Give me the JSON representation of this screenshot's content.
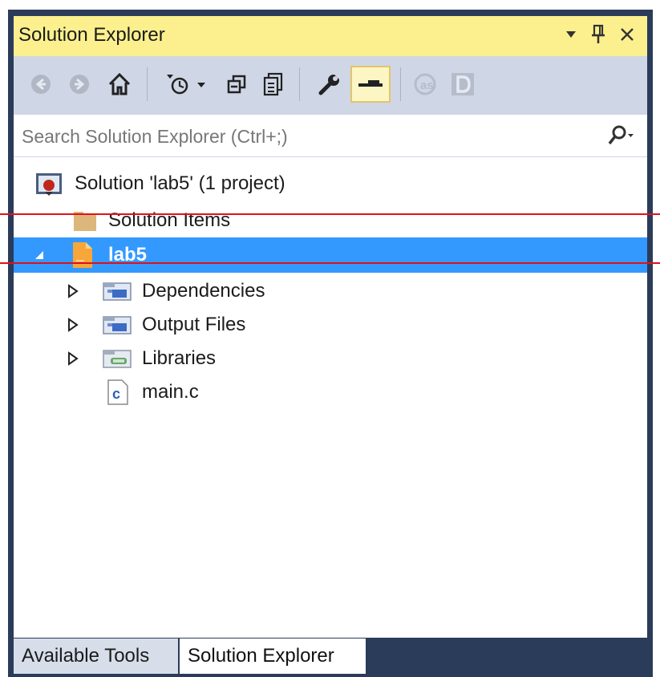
{
  "window": {
    "title": "Solution Explorer",
    "dropdown_glyph": "▼",
    "pin_glyph": "⊥",
    "close_glyph": "✕"
  },
  "toolbar": {
    "buttons": [
      {
        "name": "back-button",
        "icon": "circle-left-arrow-icon",
        "enabled": false
      },
      {
        "name": "forward-button",
        "icon": "circle-right-arrow-icon",
        "enabled": false
      },
      {
        "name": "home-button",
        "icon": "home-icon",
        "enabled": true
      },
      {
        "name": "pending-changes-filter-button",
        "icon": "clock-filter-icon",
        "enabled": true
      },
      {
        "name": "collapse-all-button",
        "icon": "collapse-all-icon",
        "enabled": true
      },
      {
        "name": "show-all-files-button",
        "icon": "show-all-files-icon",
        "enabled": true
      },
      {
        "name": "properties-button",
        "icon": "wrench-icon",
        "enabled": true
      },
      {
        "name": "preview-selected-items-button",
        "icon": "preview-icon",
        "enabled": true,
        "active": true
      },
      {
        "name": "assembly-button",
        "icon": "assembly-icon",
        "enabled": false
      },
      {
        "name": "debug-button",
        "icon": "d-letter-icon",
        "enabled": false
      }
    ]
  },
  "search": {
    "placeholder": "Search Solution Explorer (Ctrl+;)",
    "value": ""
  },
  "tree": {
    "solution": {
      "label": "Solution 'lab5' (1 project)",
      "icon": "solution-icon"
    },
    "solution_items": {
      "label": "Solution Items",
      "icon": "folder-icon"
    },
    "project": {
      "label": "lab5",
      "icon": "project-file-icon",
      "expanded": true,
      "selected": true
    },
    "children": [
      {
        "label": "Dependencies",
        "icon": "dependencies-folder-icon",
        "expandable": true
      },
      {
        "label": "Output Files",
        "icon": "output-folder-icon",
        "expandable": true
      },
      {
        "label": "Libraries",
        "icon": "libraries-folder-icon",
        "expandable": true
      },
      {
        "label": "main.c",
        "icon": "c-file-icon",
        "expandable": false
      }
    ]
  },
  "tabs": [
    {
      "label": "Available Tools",
      "active": false
    },
    {
      "label": "Solution Explorer",
      "active": true
    }
  ],
  "colors": {
    "title_bar": "#fbf08d",
    "toolbar": "#cfd6e5",
    "selection": "#3399ff",
    "annotation_line": "#e0111b",
    "frame": "#2b3b5a"
  }
}
